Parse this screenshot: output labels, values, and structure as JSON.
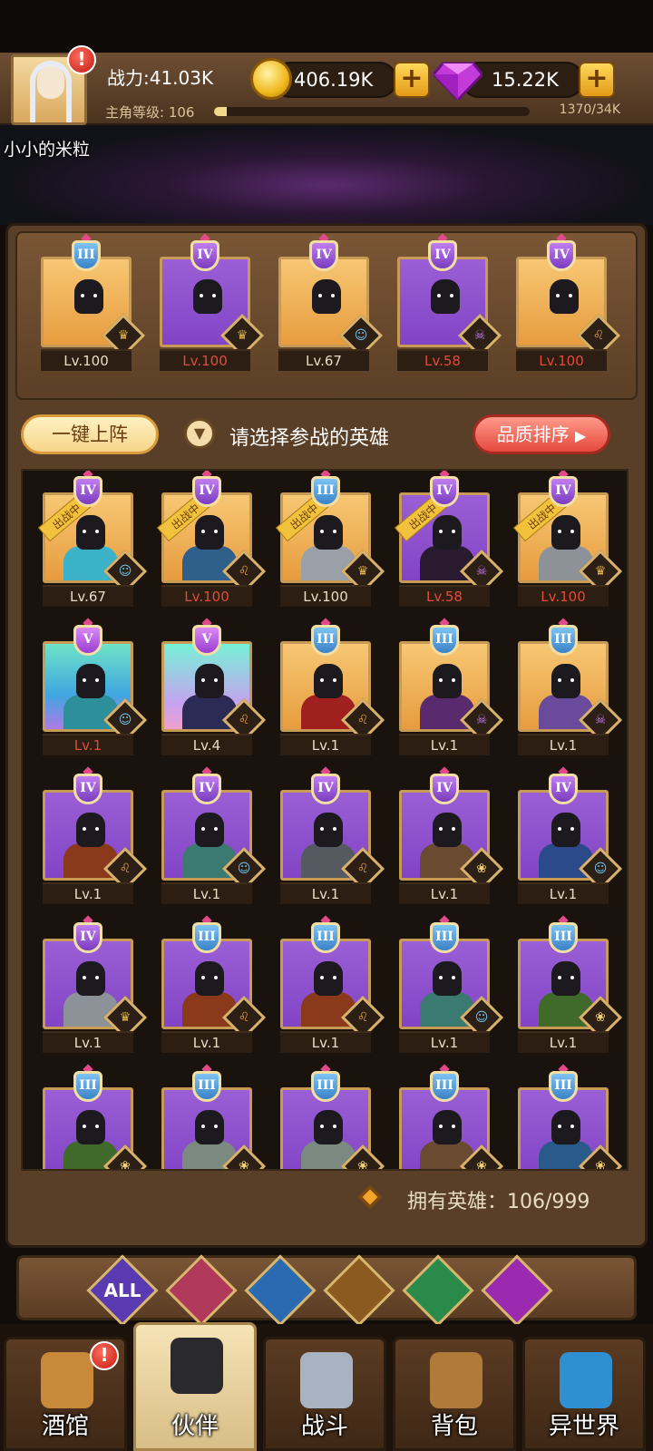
{
  "player": {
    "power_text": "战力:41.03K",
    "level_label": "主角等级:",
    "level": "106",
    "exp_text": "1370/34K",
    "exp_fraction": 0.04,
    "name": "小小的米粒",
    "gold": "406.19K",
    "gems": "15.22K"
  },
  "colors": {
    "accent_gold": "#f0b81c",
    "gem": "#c23ad8",
    "alert": "#c21d12"
  },
  "team": [
    {
      "rank": "III",
      "quality": "gold",
      "faction": "crown-icon",
      "lv": "Lv.100",
      "lv_red": false
    },
    {
      "rank": "IV",
      "quality": "purple",
      "faction": "crown-icon",
      "lv": "Lv.100",
      "lv_red": true
    },
    {
      "rank": "IV",
      "quality": "gold",
      "faction": "elf-icon",
      "lv": "Lv.67",
      "lv_red": false
    },
    {
      "rank": "IV",
      "quality": "purple",
      "faction": "demon-icon",
      "lv": "Lv.58",
      "lv_red": true
    },
    {
      "rank": "IV",
      "quality": "gold",
      "faction": "lion-icon",
      "lv": "Lv.100",
      "lv_red": true
    }
  ],
  "controls": {
    "auto_deploy": "一键上阵",
    "hint": "请选择参战的英雄",
    "sort": "品质排序"
  },
  "deployed_badge": "出战中",
  "heroes": [
    {
      "rank": "IV",
      "quality": "gold",
      "faction": "elf-icon",
      "lv": "Lv.67",
      "lv_red": false,
      "deployed": true,
      "tone": "#3bb2c8"
    },
    {
      "rank": "IV",
      "quality": "gold",
      "faction": "lion-icon",
      "lv": "Lv.100",
      "lv_red": true,
      "deployed": true,
      "tone": "#2f5f8a"
    },
    {
      "rank": "III",
      "quality": "gold",
      "faction": "crown-icon",
      "lv": "Lv.100",
      "lv_red": false,
      "deployed": true,
      "tone": "#9aa0a8"
    },
    {
      "rank": "IV",
      "quality": "purple",
      "faction": "demon-icon",
      "lv": "Lv.58",
      "lv_red": true,
      "deployed": true,
      "tone": "#2a1a30"
    },
    {
      "rank": "IV",
      "quality": "gold",
      "faction": "crown-icon",
      "lv": "Lv.100",
      "lv_red": true,
      "deployed": true,
      "tone": "#8d9299"
    },
    {
      "rank": "V",
      "quality": "teal",
      "faction": "elf-icon",
      "lv": "Lv.1",
      "lv_red": true,
      "deployed": false,
      "tone": "#2c8f9a"
    },
    {
      "rank": "V",
      "quality": "tealpink",
      "faction": "lion-icon",
      "lv": "Lv.4",
      "lv_red": false,
      "deployed": false,
      "tone": "#2b2b55"
    },
    {
      "rank": "III",
      "quality": "gold",
      "faction": "lion-icon",
      "lv": "Lv.1",
      "lv_red": false,
      "deployed": false,
      "tone": "#a02020"
    },
    {
      "rank": "III",
      "quality": "gold",
      "faction": "demon-icon",
      "lv": "Lv.1",
      "lv_red": false,
      "deployed": false,
      "tone": "#5a2a6e"
    },
    {
      "rank": "III",
      "quality": "gold",
      "faction": "demon-icon",
      "lv": "Lv.1",
      "lv_red": false,
      "deployed": false,
      "tone": "#6a4a9a"
    },
    {
      "rank": "IV",
      "quality": "purple",
      "faction": "lion-icon",
      "lv": "Lv.1",
      "lv_red": false,
      "deployed": false,
      "tone": "#8a3a1a"
    },
    {
      "rank": "IV",
      "quality": "purple",
      "faction": "elf-icon",
      "lv": "Lv.1",
      "lv_red": false,
      "deployed": false,
      "tone": "#3a7a70"
    },
    {
      "rank": "IV",
      "quality": "purple",
      "faction": "lion-icon",
      "lv": "Lv.1",
      "lv_red": false,
      "deployed": false,
      "tone": "#555a60"
    },
    {
      "rank": "IV",
      "quality": "purple",
      "faction": "forest-icon",
      "lv": "Lv.1",
      "lv_red": false,
      "deployed": false,
      "tone": "#6a4a30"
    },
    {
      "rank": "IV",
      "quality": "purple",
      "faction": "elf-icon",
      "lv": "Lv.1",
      "lv_red": false,
      "deployed": false,
      "tone": "#2a4a8a"
    },
    {
      "rank": "IV",
      "quality": "purple",
      "faction": "crown-icon",
      "lv": "Lv.1",
      "lv_red": false,
      "deployed": false,
      "tone": "#8d9299"
    },
    {
      "rank": "III",
      "quality": "purple",
      "faction": "lion-icon",
      "lv": "Lv.1",
      "lv_red": false,
      "deployed": false,
      "tone": "#8a3a1a"
    },
    {
      "rank": "III",
      "quality": "purple",
      "faction": "lion-icon",
      "lv": "Lv.1",
      "lv_red": false,
      "deployed": false,
      "tone": "#8a3a1a"
    },
    {
      "rank": "III",
      "quality": "purple",
      "faction": "elf-icon",
      "lv": "Lv.1",
      "lv_red": false,
      "deployed": false,
      "tone": "#3a7a70"
    },
    {
      "rank": "III",
      "quality": "purple",
      "faction": "forest-icon",
      "lv": "Lv.1",
      "lv_red": false,
      "deployed": false,
      "tone": "#3f6a2a"
    },
    {
      "rank": "III",
      "quality": "purple",
      "faction": "forest-icon",
      "lv": "",
      "lv_red": false,
      "deployed": false,
      "tone": "#3f6a2a"
    },
    {
      "rank": "III",
      "quality": "purple",
      "faction": "forest-icon",
      "lv": "",
      "lv_red": false,
      "deployed": false,
      "tone": "#7a8a80"
    },
    {
      "rank": "III",
      "quality": "purple",
      "faction": "forest-icon",
      "lv": "",
      "lv_red": false,
      "deployed": false,
      "tone": "#7a8a80"
    },
    {
      "rank": "III",
      "quality": "purple",
      "faction": "forest-icon",
      "lv": "",
      "lv_red": false,
      "deployed": false,
      "tone": "#6a4a30"
    },
    {
      "rank": "III",
      "quality": "purple",
      "faction": "forest-icon",
      "lv": "",
      "lv_red": false,
      "deployed": false,
      "tone": "#2a5a8a"
    }
  ],
  "owned_heroes_text": "拥有英雄：106/999",
  "filters": [
    {
      "label": "ALL",
      "icon": "all-filter-icon",
      "color": "#5a3ab0"
    },
    {
      "label": "",
      "icon": "crown-faction-icon",
      "color": "#b0385a"
    },
    {
      "label": "",
      "icon": "elf-faction-icon",
      "color": "#2a6ab0"
    },
    {
      "label": "",
      "icon": "lion-faction-icon",
      "color": "#8a5a20"
    },
    {
      "label": "",
      "icon": "forest-faction-icon",
      "color": "#2a8a4a"
    },
    {
      "label": "",
      "icon": "demon-faction-icon",
      "color": "#9a2ab0"
    }
  ],
  "nav": [
    {
      "label": "酒馆",
      "icon": "tavern-mug-icon",
      "active": false,
      "alert": true
    },
    {
      "label": "伙伴",
      "icon": "partner-icon",
      "active": true,
      "alert": false
    },
    {
      "label": "战斗",
      "icon": "crossed-swords-icon",
      "active": false,
      "alert": false
    },
    {
      "label": "背包",
      "icon": "backpack-icon",
      "active": false,
      "alert": false
    },
    {
      "label": "异世界",
      "icon": "portal-icon",
      "active": false,
      "alert": false
    }
  ]
}
